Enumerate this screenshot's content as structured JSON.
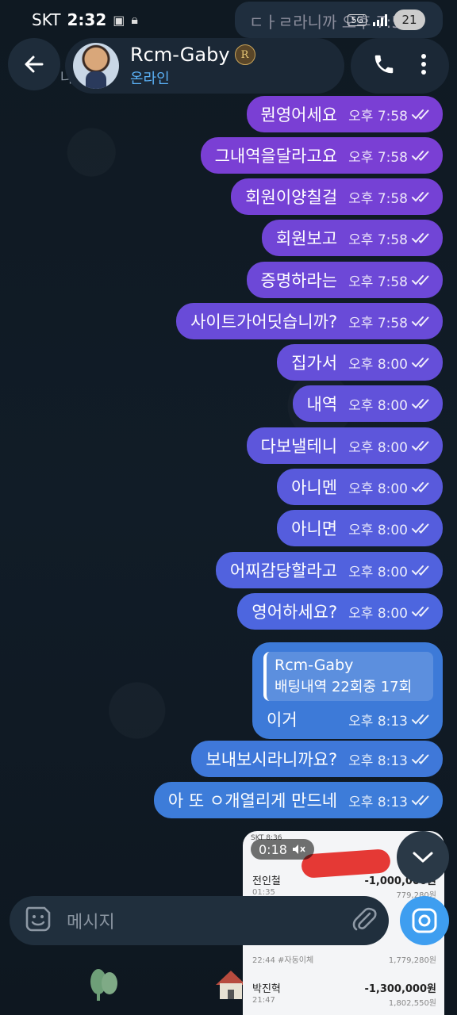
{
  "status_bar": {
    "carrier": "SKT",
    "time": "2:32",
    "network": "5G",
    "battery": "21"
  },
  "header": {
    "name": "Rcm-Gaby",
    "crest": "R",
    "status": "온라인",
    "prev_bubble": "ㄷㅏㄹ라니까 오후 7:58",
    "peek": "나"
  },
  "messages": [
    {
      "text": "뭔영어세요",
      "time": "오후 7:58",
      "color": "#7a3fd4"
    },
    {
      "text": "그내역을달라고요",
      "time": "오후 7:58",
      "color": "#7a3fd4"
    },
    {
      "text": "회원이양칠걸",
      "time": "오후 7:58",
      "color": "#7541d5"
    },
    {
      "text": "회원보고",
      "time": "오후 7:58",
      "color": "#7145d6"
    },
    {
      "text": "증명하라는",
      "time": "오후 7:58",
      "color": "#6d48d7"
    },
    {
      "text": "사이트가어딧습니까?",
      "time": "오후 7:58",
      "color": "#694bd8"
    },
    {
      "text": "집가서",
      "time": "오후 8:00",
      "color": "#654fd9"
    },
    {
      "text": "내역",
      "time": "오후 8:00",
      "color": "#6152da"
    },
    {
      "text": "다보낼테니",
      "time": "오후 8:00",
      "color": "#5d56db"
    },
    {
      "text": "아니멘",
      "time": "오후 8:00",
      "color": "#595adc"
    },
    {
      "text": "아니면",
      "time": "오후 8:00",
      "color": "#555ddd"
    },
    {
      "text": "어찌감당할라고",
      "time": "오후 8:00",
      "color": "#5162de"
    },
    {
      "text": "영어하세요?",
      "time": "오후 8:00",
      "color": "#4d66df"
    },
    {
      "text": "보내보시라니까요?",
      "time": "오후 8:13",
      "color": "#3f78d9"
    },
    {
      "text": "아 또 ㅇ개열리게 만드네",
      "time": "오후 8:13",
      "color": "#3d7cd9"
    }
  ],
  "reply": {
    "quote_name": "Rcm-Gaby",
    "quote_text": "배팅내역 22회중 17회",
    "text": "이거",
    "time": "오후 8:13"
  },
  "video": {
    "duration": "0:18",
    "header_text": "SKT 8:36",
    "rows": [
      {
        "name": "전인철",
        "amount": "-1,000,000원",
        "time": "01:35",
        "balance": "779,280원"
      },
      {
        "name": "",
        "amount": "",
        "time": "22:44 #자동이체",
        "balance": "1,779,280원"
      },
      {
        "name": "박진혁",
        "amount": "-1,300,000원",
        "time": "21:47",
        "balance": "1,802,550원"
      }
    ]
  },
  "input": {
    "placeholder": "메시지"
  },
  "colors": {
    "accent": "#3e9ef0",
    "online": "#5ab0f5",
    "background": "#101a24"
  },
  "icons": [
    "back-arrow-icon",
    "phone-icon",
    "more-vertical-icon",
    "sticker-icon",
    "attach-icon",
    "camera-icon",
    "chevron-down-icon",
    "read-check-icon",
    "mute-icon"
  ]
}
